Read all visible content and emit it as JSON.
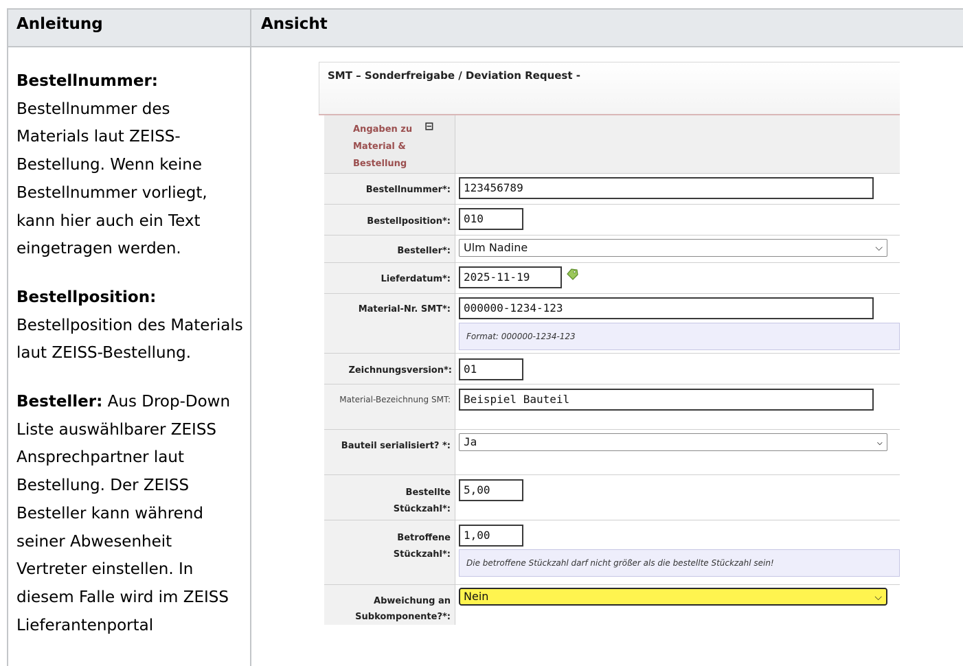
{
  "header": {
    "left": "Anleitung",
    "right": "Ansicht"
  },
  "instructions": {
    "bestellnummer_title": "Bestellnummer:",
    "bestellnummer_text": "Bestellnummer des Materials laut ZEISS-Bestellung. Wenn keine Bestellnummer vorliegt, kann hier auch ein Text eingetragen werden.",
    "bestellposition_title": "Bestellposition:",
    "bestellposition_text": "Bestellposition des Materials laut ZEISS-Bestellung.",
    "besteller_title": "Besteller:",
    "besteller_text": "Aus Drop-Down Liste auswählbarer ZEISS Ansprechpartner laut Bestellung. Der ZEISS Besteller kann während seiner Abwesenheit Vertreter einstellen. In diesem Falle wird im ZEISS Lieferantenportal"
  },
  "form": {
    "title": "SMT – Sonderfreigabe / Deviation Request -",
    "section_label": "Angaben zu Material & Bestellung",
    "section_toggle": "⊟",
    "fields": {
      "bestellnummer": {
        "label": "Bestellnummer*:",
        "value": "123456789"
      },
      "bestellposition": {
        "label": "Bestellposition*:",
        "value": "010"
      },
      "besteller": {
        "label": "Besteller*:",
        "value": "Ulm Nadine"
      },
      "lieferdatum": {
        "label": "Lieferdatum*:",
        "value": "2025-11-19"
      },
      "material_nr": {
        "label": "Material-Nr. SMT*:",
        "value": "000000-1234-123",
        "hint": "Format: 000000-1234-123"
      },
      "zeichnungsversion": {
        "label": "Zeichnungsversion*:",
        "value": "01"
      },
      "material_bezeichnung": {
        "label": "Material-Bezeichnung SMT:",
        "value": "Beispiel Bauteil"
      },
      "serialisiert": {
        "label": "Bauteil serialisiert? *:",
        "value": "Ja"
      },
      "bestellte_stueckzahl": {
        "label": "Bestellte Stückzahl*:",
        "value": "5,00"
      },
      "betroffene_stueckzahl": {
        "label": "Betroffene Stückzahl*:",
        "value": "1,00",
        "hint": "Die betroffene Stückzahl darf nicht größer als die bestellte Stückzahl sein!"
      },
      "abweichung_sub": {
        "label": "Abweichung an Subkomponente?*:",
        "value": "Nein"
      }
    },
    "colors": {
      "highlight": "#fff44f",
      "section_label": "#9b4f4f"
    },
    "icons": {
      "calendar": "calendar-icon",
      "select": "chevron-down-icon"
    }
  }
}
